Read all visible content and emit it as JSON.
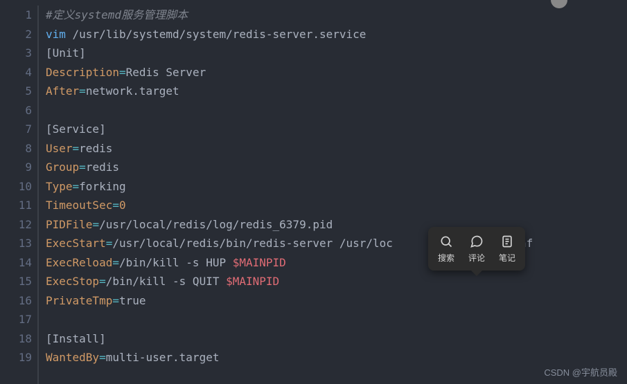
{
  "lines": [
    {
      "n": "1",
      "segments": [
        {
          "cls": "comment",
          "t": "#定义systemd服务管理脚本"
        }
      ]
    },
    {
      "n": "2",
      "segments": [
        {
          "cls": "cmd",
          "t": "vim"
        },
        {
          "cls": "path",
          "t": " /usr/lib/systemd/system/redis-server.service"
        }
      ]
    },
    {
      "n": "3",
      "segments": [
        {
          "cls": "bracket",
          "t": "[Unit]"
        }
      ]
    },
    {
      "n": "4",
      "segments": [
        {
          "cls": "key",
          "t": "Description"
        },
        {
          "cls": "eq",
          "t": "="
        },
        {
          "cls": "value",
          "t": "Redis Server"
        }
      ]
    },
    {
      "n": "5",
      "segments": [
        {
          "cls": "key",
          "t": "After"
        },
        {
          "cls": "eq",
          "t": "="
        },
        {
          "cls": "value",
          "t": "network.target"
        }
      ]
    },
    {
      "n": "6",
      "segments": []
    },
    {
      "n": "7",
      "segments": [
        {
          "cls": "bracket",
          "t": "[Service]"
        }
      ]
    },
    {
      "n": "8",
      "segments": [
        {
          "cls": "key",
          "t": "User"
        },
        {
          "cls": "eq",
          "t": "="
        },
        {
          "cls": "value",
          "t": "redis"
        }
      ]
    },
    {
      "n": "9",
      "segments": [
        {
          "cls": "key",
          "t": "Group"
        },
        {
          "cls": "eq",
          "t": "="
        },
        {
          "cls": "value",
          "t": "redis"
        }
      ]
    },
    {
      "n": "10",
      "segments": [
        {
          "cls": "key",
          "t": "Type"
        },
        {
          "cls": "eq",
          "t": "="
        },
        {
          "cls": "value",
          "t": "forking"
        }
      ]
    },
    {
      "n": "11",
      "segments": [
        {
          "cls": "key",
          "t": "TimeoutSec"
        },
        {
          "cls": "eq",
          "t": "="
        },
        {
          "cls": "num",
          "t": "0"
        }
      ]
    },
    {
      "n": "12",
      "segments": [
        {
          "cls": "key",
          "t": "PIDFile"
        },
        {
          "cls": "eq",
          "t": "="
        },
        {
          "cls": "value",
          "t": "/usr/local/redis/log/redis_6379.pid"
        }
      ]
    },
    {
      "n": "13",
      "segments": [
        {
          "cls": "key",
          "t": "ExecStart"
        },
        {
          "cls": "eq",
          "t": "="
        },
        {
          "cls": "value",
          "t": "/usr/local/redis/bin/redis-server /usr/loc            edis.conf"
        }
      ]
    },
    {
      "n": "14",
      "segments": [
        {
          "cls": "key",
          "t": "ExecReload"
        },
        {
          "cls": "eq",
          "t": "="
        },
        {
          "cls": "value",
          "t": "/bin/kill -s HUP "
        },
        {
          "cls": "var",
          "t": "$MAINPID"
        }
      ]
    },
    {
      "n": "15",
      "segments": [
        {
          "cls": "key",
          "t": "ExecStop"
        },
        {
          "cls": "eq",
          "t": "="
        },
        {
          "cls": "value",
          "t": "/bin/kill -s QUIT "
        },
        {
          "cls": "var",
          "t": "$MAINPID"
        }
      ]
    },
    {
      "n": "16",
      "segments": [
        {
          "cls": "key",
          "t": "PrivateTmp"
        },
        {
          "cls": "eq",
          "t": "="
        },
        {
          "cls": "value",
          "t": "true"
        }
      ]
    },
    {
      "n": "17",
      "segments": []
    },
    {
      "n": "18",
      "segments": [
        {
          "cls": "bracket",
          "t": "[Install]"
        }
      ]
    },
    {
      "n": "19",
      "segments": [
        {
          "cls": "key",
          "t": "WantedBy"
        },
        {
          "cls": "eq",
          "t": "="
        },
        {
          "cls": "value",
          "t": "multi-user.target"
        }
      ]
    }
  ],
  "tooltip": {
    "search": "搜索",
    "comment": "评论",
    "note": "笔记"
  },
  "watermark": "CSDN @宇航员殿"
}
